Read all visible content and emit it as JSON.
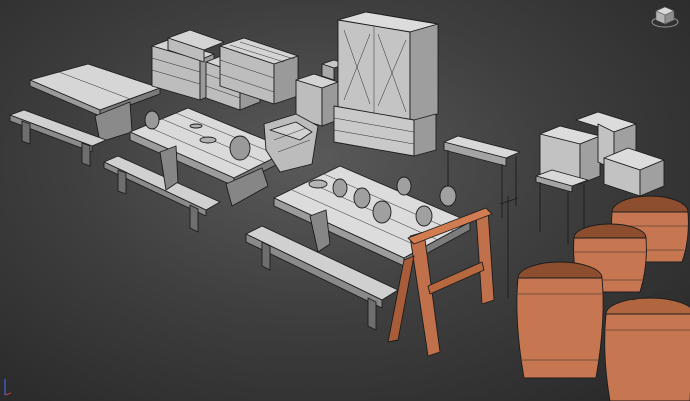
{
  "viewport": {
    "background": "#3f3f3f",
    "mesh_color": "#cfcfcf",
    "wood_color": "#c0704a",
    "wire_color": "#1c1c1c"
  },
  "overlay": {
    "viewcube_icon": "viewcube-icon",
    "axis_icon": "axis-gizmo-icon"
  }
}
